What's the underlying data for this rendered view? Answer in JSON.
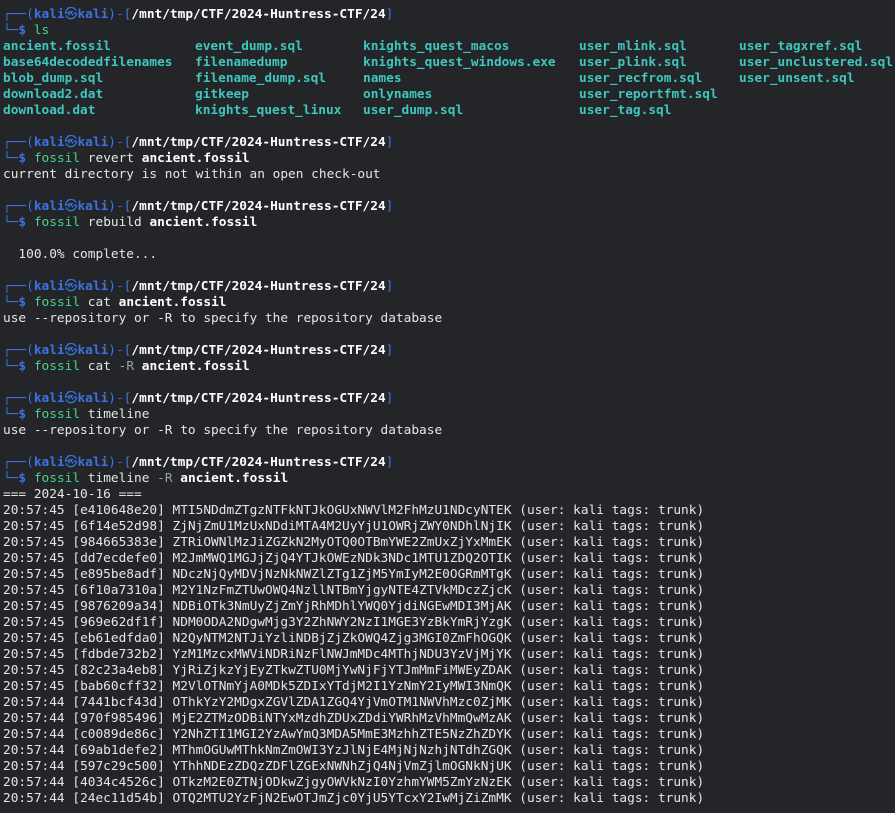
{
  "prompt": {
    "user": "kali",
    "host": "kali",
    "cwd": "/mnt/tmp/CTF/2024-Huntress-CTF/24",
    "skull_glyph": "㉿"
  },
  "commands": [
    {
      "cmd": "ls",
      "args": []
    },
    {
      "cmd": "fossil",
      "args": [
        {
          "text": "revert",
          "style": "arg"
        },
        {
          "text": "ancient.fossil",
          "style": "bold"
        }
      ],
      "output": [
        "current directory is not within an open check-out"
      ]
    },
    {
      "cmd": "fossil",
      "args": [
        {
          "text": "rebuild",
          "style": "arg"
        },
        {
          "text": "ancient.fossil",
          "style": "bold"
        }
      ],
      "output": [
        "",
        "  100.0% complete..."
      ]
    },
    {
      "cmd": "fossil",
      "args": [
        {
          "text": "cat",
          "style": "arg"
        },
        {
          "text": "ancient.fossil",
          "style": "bold"
        }
      ],
      "output": [
        "use --repository or -R to specify the repository database"
      ]
    },
    {
      "cmd": "fossil",
      "args": [
        {
          "text": "cat",
          "style": "arg"
        },
        {
          "text": "-R",
          "style": "flag"
        },
        {
          "text": "ancient.fossil",
          "style": "bold"
        }
      ],
      "output": []
    },
    {
      "cmd": "fossil",
      "args": [
        {
          "text": "timeline",
          "style": "arg"
        }
      ],
      "output": [
        "use --repository or -R to specify the repository database"
      ]
    },
    {
      "cmd": "fossil",
      "args": [
        {
          "text": "timeline",
          "style": "arg"
        },
        {
          "text": "-R",
          "style": "flag"
        },
        {
          "text": "ancient.fossil",
          "style": "bold"
        }
      ],
      "output": []
    }
  ],
  "ls_files": [
    [
      "ancient.fossil",
      "event_dump.sql",
      "knights_quest_macos",
      "user_mlink.sql",
      "user_tagxref.sql"
    ],
    [
      "base64decodedfilenames",
      "filenamedump",
      "knights_quest_windows.exe",
      "user_plink.sql",
      "user_unclustered.sql"
    ],
    [
      "blob_dump.sql",
      "filename_dump.sql",
      "names",
      "user_recfrom.sql",
      "user_unsent.sql"
    ],
    [
      "download2.dat",
      "gitkeep",
      "onlynames",
      "user_reportfmt.sql",
      ""
    ],
    [
      "download.dat",
      "knights_quest_linux",
      "user_dump.sql",
      "user_tag.sql",
      ""
    ]
  ],
  "timeline": {
    "date_header": "=== 2024-10-16 ===",
    "entries": [
      {
        "time": "20:57:45",
        "hash": "e410648e20",
        "comment": "MTI5NDdmZTgzNTFkNTJkOGUxNWVlM2FhMzU1NDcyNTEK",
        "user": "kali",
        "tags": "trunk"
      },
      {
        "time": "20:57:45",
        "hash": "6f14e52d98",
        "comment": "ZjNjZmU1MzUxNDdiMTA4M2UyYjU1OWRjZWY0NDhlNjIK",
        "user": "kali",
        "tags": "trunk"
      },
      {
        "time": "20:57:45",
        "hash": "984665383e",
        "comment": "ZTRiOWNlMzJiZGZkN2MyOTQ0OTBmYWE2ZmUxZjYxMmEK",
        "user": "kali",
        "tags": "trunk"
      },
      {
        "time": "20:57:45",
        "hash": "dd7ecdefe0",
        "comment": "M2JmMWQ1MGJjZjQ4YTJkOWEzNDk3NDc1MTU1ZDQ2OTIK",
        "user": "kali",
        "tags": "trunk"
      },
      {
        "time": "20:57:45",
        "hash": "e895be8adf",
        "comment": "NDczNjQyMDVjNzNkNWZlZTg1ZjM5YmIyM2E0OGRmMTgK",
        "user": "kali",
        "tags": "trunk"
      },
      {
        "time": "20:57:45",
        "hash": "6f10a7310a",
        "comment": "M2Y1NzFmZTUwOWQ4NzllNTBmYjgyNTE4ZTVkMDczZjcK",
        "user": "kali",
        "tags": "trunk"
      },
      {
        "time": "20:57:45",
        "hash": "9876209a34",
        "comment": "NDBiOTk3NmUyZjZmYjRhMDhlYWQ0YjdiNGEwMDI3MjAK",
        "user": "kali",
        "tags": "trunk"
      },
      {
        "time": "20:57:45",
        "hash": "969e62df1f",
        "comment": "NDM0ODA2NDgwMjg3Y2ZhNWY2NzI1MGE3YzBkYmRjYzgK",
        "user": "kali",
        "tags": "trunk"
      },
      {
        "time": "20:57:45",
        "hash": "eb61edfda0",
        "comment": "N2QyNTM2NTJiYzliNDBjZjZkOWQ4Zjg3MGI0ZmFhOGQK",
        "user": "kali",
        "tags": "trunk"
      },
      {
        "time": "20:57:45",
        "hash": "fdbde732b2",
        "comment": "YzM1MzcxMWViNDRiNzFlNWJmMDc4MThjNDU3YzVjMjYK",
        "user": "kali",
        "tags": "trunk"
      },
      {
        "time": "20:57:45",
        "hash": "82c23a4eb8",
        "comment": "YjRiZjkzYjEyZTkwZTU0MjYwNjFjYTJmMmFiMWEyZDAK",
        "user": "kali",
        "tags": "trunk"
      },
      {
        "time": "20:57:45",
        "hash": "bab60cff32",
        "comment": "M2VlOTNmYjA0MDk5ZDIxYTdjM2I1YzNmY2IyMWI3NmQK",
        "user": "kali",
        "tags": "trunk"
      },
      {
        "time": "20:57:44",
        "hash": "7441bcf43d",
        "comment": "OThkYzY2MDgxZGVlZDA1ZGQ4YjVmOTM1NWVhMzc0ZjMK",
        "user": "kali",
        "tags": "trunk"
      },
      {
        "time": "20:57:44",
        "hash": "970f985496",
        "comment": "MjE2ZTMzODBiNTYxMzdhZDUxZDdiYWRhMzVhMmQwMzAK",
        "user": "kali",
        "tags": "trunk"
      },
      {
        "time": "20:57:44",
        "hash": "c0089de86c",
        "comment": "Y2NhZTI1MGI2YzAwYmQ3MDA5MmE3MzhhZTE5NzZhZDYK",
        "user": "kali",
        "tags": "trunk"
      },
      {
        "time": "20:57:44",
        "hash": "69ab1defe2",
        "comment": "MThmOGUwMThkNmZmOWI3YzJlNjE4MjNjNzhjNTdhZGQK",
        "user": "kali",
        "tags": "trunk"
      },
      {
        "time": "20:57:44",
        "hash": "597c29c500",
        "comment": "YThhNDEzZDQzZDFlZGExNWNhZjQ4NjVmZjlmOGNkNjUK",
        "user": "kali",
        "tags": "trunk"
      },
      {
        "time": "20:57:44",
        "hash": "4034c4526c",
        "comment": "OTkzM2E0ZTNjODkwZjgyOWVkNzI0YzhmYWM5ZmYzNzEK",
        "user": "kali",
        "tags": "trunk"
      },
      {
        "time": "20:57:44",
        "hash": "24ec11d54b",
        "comment": "OTQ2MTU2YzFjN2EwOTJmZjc0YjU5YTcxY2IwMjZiZmMK",
        "user": "kali",
        "tags": "trunk"
      }
    ]
  },
  "colors": {
    "background": "#232528",
    "prompt_blue": "#3c73e0",
    "command_green": "#47d38a",
    "ls_file_cyan": "#3fc7bd",
    "text": "#e6e6e6"
  }
}
